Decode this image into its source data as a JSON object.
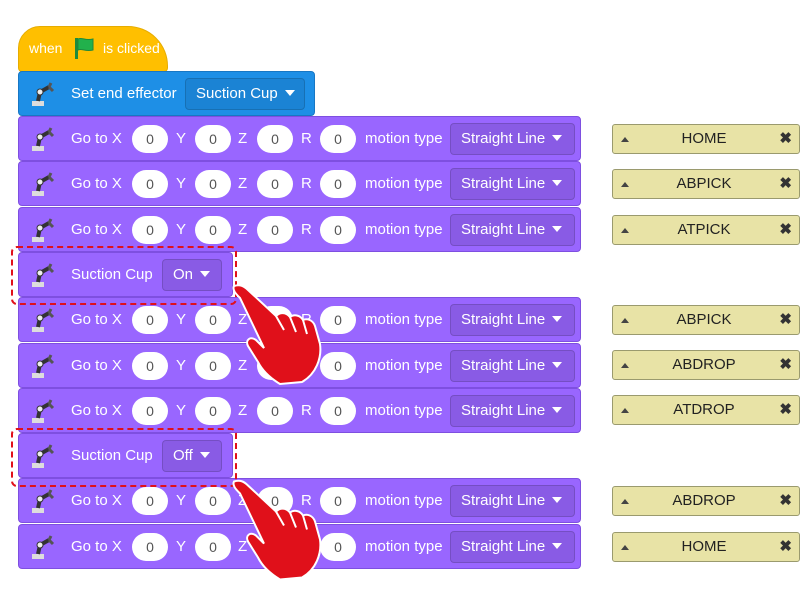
{
  "hat": {
    "when": "when",
    "clicked": "is clicked",
    "flag_color": "#22B14C",
    "flag_icon": "green-flag-icon"
  },
  "set_end_effector": {
    "label": "Set end effector",
    "value": "Suction Cup"
  },
  "goto_labels": {
    "goto_x": "Go to X",
    "y": "Y",
    "z": "Z",
    "r": "R",
    "motion_type": "motion type"
  },
  "rows": [
    {
      "type": "goto",
      "x": "0",
      "y": "0",
      "z": "0",
      "r": "0",
      "motion": "Straight Line",
      "tag": "HOME"
    },
    {
      "type": "goto",
      "x": "0",
      "y": "0",
      "z": "0",
      "r": "0",
      "motion": "Straight Line",
      "tag": "ABPICK"
    },
    {
      "type": "goto",
      "x": "0",
      "y": "0",
      "z": "0",
      "r": "0",
      "motion": "Straight Line",
      "tag": "ATPICK"
    },
    {
      "type": "suction",
      "label": "Suction Cup",
      "value": "On"
    },
    {
      "type": "goto",
      "x": "0",
      "y": "0",
      "z": "0",
      "r": "0",
      "motion": "Straight Line",
      "tag": "ABPICK"
    },
    {
      "type": "goto",
      "x": "0",
      "y": "0",
      "z": "0",
      "r": "0",
      "motion": "Straight Line",
      "tag": "ABDROP"
    },
    {
      "type": "goto",
      "x": "0",
      "y": "0",
      "z": "0",
      "r": "0",
      "motion": "Straight Line",
      "tag": "ATDROP"
    },
    {
      "type": "suction",
      "label": "Suction Cup",
      "value": "Off"
    },
    {
      "type": "goto",
      "x": "0",
      "y": "0",
      "z": "0",
      "r": "0",
      "motion": "Straight Line",
      "tag": "ABDROP"
    },
    {
      "type": "goto",
      "x": "0",
      "y": "0",
      "z": "0",
      "r": "0",
      "motion": "Straight Line",
      "tag": "HOME"
    }
  ],
  "colors": {
    "event": "#FFBF00",
    "blue_block": "#1E8FE6",
    "purple_block": "#9966FF",
    "tag": "#E8E3A6",
    "highlight": "#E0101A",
    "hand": "#E0101A"
  },
  "icons": {
    "arm": "robot-arm-icon",
    "pointer": "pointing-hand-icon",
    "tag_caret": "caret-up-icon",
    "tag_remove": "close-icon"
  }
}
